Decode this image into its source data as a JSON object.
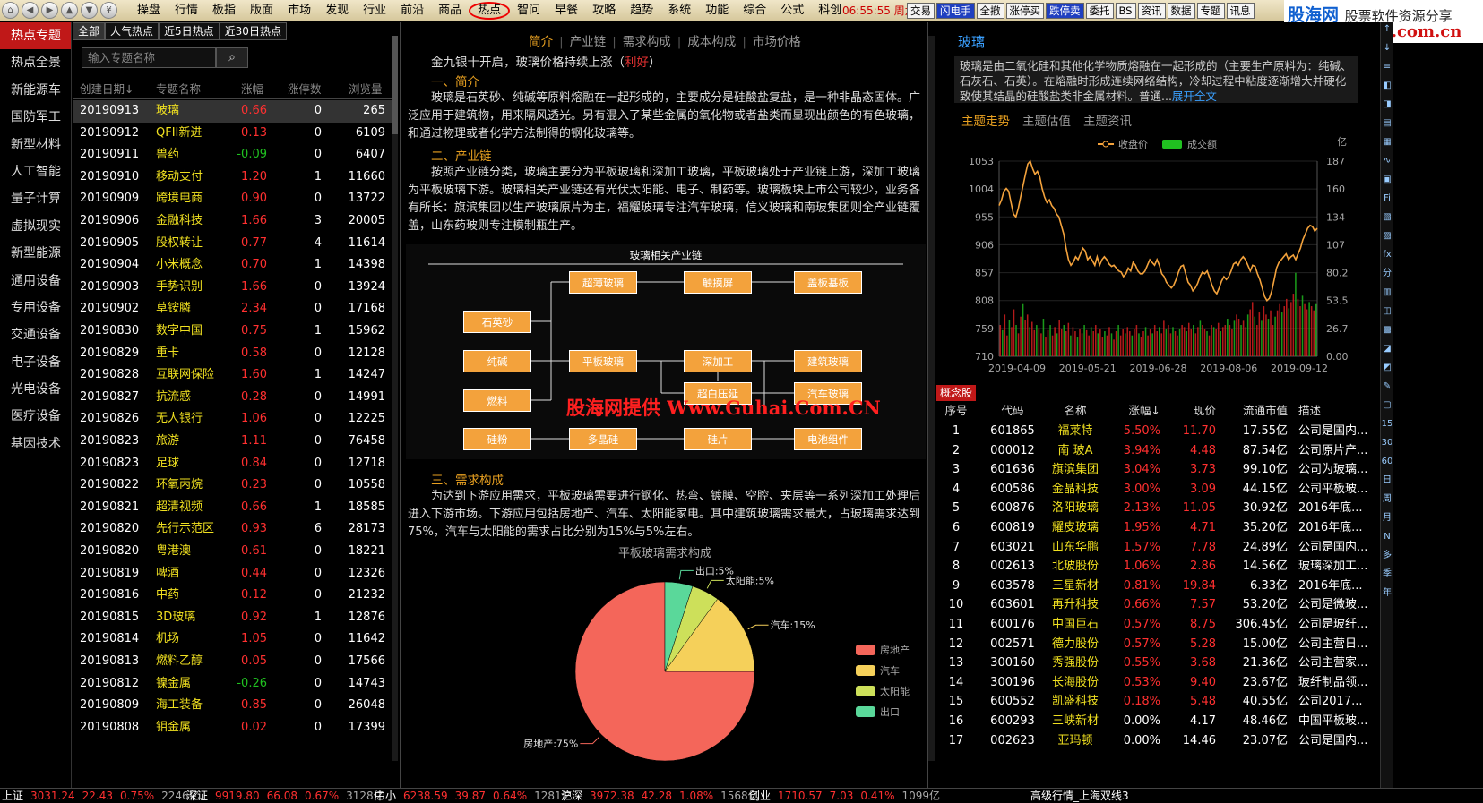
{
  "menu": {
    "items": [
      "操盘",
      "行情",
      "板指",
      "版面",
      "市场",
      "发现",
      "行业",
      "前沿",
      "商品",
      "热点",
      "智问",
      "早餐",
      "攻略",
      "趋势",
      "系统",
      "功能",
      "综合",
      "公式",
      "科创"
    ],
    "active": "热点",
    "time": "06:55:55",
    "weekday": "周六"
  },
  "quick_buttons": [
    "交易",
    "闪电手",
    "全撤",
    "涨停买",
    "跌停卖",
    "委托",
    "BS",
    "资讯",
    "数据",
    "专题",
    "讯息"
  ],
  "logo": {
    "line1": "股海网",
    "line1b": "股票软件资源分享",
    "line2": "Www.Guhai.com.cn"
  },
  "categories": [
    "热点专题",
    "热点全景",
    "新能源车",
    "国防军工",
    "新型材料",
    "人工智能",
    "量子计算",
    "虚拟现实",
    "新型能源",
    "通用设备",
    "专用设备",
    "交通设备",
    "电子设备",
    "光电设备",
    "医疗设备",
    "基因技术"
  ],
  "topic_tabs": [
    "全部",
    "人气热点",
    "近5日热点",
    "近30日热点"
  ],
  "topic_search": {
    "placeholder": "输入专题名称"
  },
  "topic_headers": [
    "创建日期↓",
    "专题名称",
    "涨幅",
    "涨停数",
    "浏览量"
  ],
  "topics": [
    [
      "20190913",
      "玻璃",
      "0.66",
      "0",
      "265",
      "up"
    ],
    [
      "20190912",
      "QFII新进",
      "0.13",
      "0",
      "6109",
      "up"
    ],
    [
      "20190911",
      "兽药",
      "-0.09",
      "0",
      "6407",
      "down"
    ],
    [
      "20190910",
      "移动支付",
      "1.20",
      "1",
      "11660",
      "up"
    ],
    [
      "20190909",
      "跨境电商",
      "0.90",
      "0",
      "13722",
      "up"
    ],
    [
      "20190906",
      "金融科技",
      "1.66",
      "3",
      "20005",
      "up"
    ],
    [
      "20190905",
      "股权转让",
      "0.77",
      "4",
      "11614",
      "up"
    ],
    [
      "20190904",
      "小米概念",
      "0.70",
      "1",
      "14398",
      "up"
    ],
    [
      "20190903",
      "手势识别",
      "1.66",
      "0",
      "13924",
      "up"
    ],
    [
      "20190902",
      "草铵膦",
      "2.34",
      "0",
      "17168",
      "up"
    ],
    [
      "20190830",
      "数字中国",
      "0.75",
      "1",
      "15962",
      "up"
    ],
    [
      "20190829",
      "重卡",
      "0.58",
      "0",
      "12128",
      "up"
    ],
    [
      "20190828",
      "互联网保险",
      "1.60",
      "1",
      "14247",
      "up"
    ],
    [
      "20190827",
      "抗流感",
      "0.28",
      "0",
      "14991",
      "up"
    ],
    [
      "20190826",
      "无人银行",
      "1.06",
      "0",
      "12225",
      "up"
    ],
    [
      "20190823",
      "旅游",
      "1.11",
      "0",
      "76458",
      "up"
    ],
    [
      "20190823",
      "足球",
      "0.84",
      "0",
      "12718",
      "up"
    ],
    [
      "20190822",
      "环氧丙烷",
      "0.23",
      "0",
      "10558",
      "up"
    ],
    [
      "20190821",
      "超清视频",
      "0.66",
      "1",
      "18585",
      "up"
    ],
    [
      "20190820",
      "先行示范区",
      "0.93",
      "6",
      "28173",
      "up"
    ],
    [
      "20190820",
      "粤港澳",
      "0.61",
      "0",
      "18221",
      "up"
    ],
    [
      "20190819",
      "啤酒",
      "0.44",
      "0",
      "12326",
      "up"
    ],
    [
      "20190816",
      "中药",
      "0.12",
      "0",
      "21232",
      "up"
    ],
    [
      "20190815",
      "3D玻璃",
      "0.92",
      "1",
      "12876",
      "up"
    ],
    [
      "20190814",
      "机场",
      "1.05",
      "0",
      "11642",
      "up"
    ],
    [
      "20190813",
      "燃料乙醇",
      "0.05",
      "0",
      "17566",
      "up"
    ],
    [
      "20190812",
      "镍金属",
      "-0.26",
      "0",
      "14743",
      "down"
    ],
    [
      "20190809",
      "海工装备",
      "0.85",
      "0",
      "26048",
      "up"
    ],
    [
      "20190808",
      "钼金属",
      "0.02",
      "0",
      "17399",
      "up"
    ]
  ],
  "article": {
    "tabs": [
      "简介",
      "产业链",
      "需求构成",
      "成本构成",
      "市场价格"
    ],
    "headline": "金九银十开启，玻璃价格持续上涨（",
    "headline_tag": "利好",
    "headline_end": "）",
    "sec1": "一、简介",
    "p1": "玻璃是石英砂、纯碱等原料熔融在一起形成的，主要成分是硅酸盐复盐，是一种非晶态固体。广泛应用于建筑物，用来隔风透光。另有混入了某些金属的氧化物或者盐类而显现出颜色的有色玻璃，和通过物理或者化学方法制得的钢化玻璃等。",
    "sec2": "二、产业链",
    "p2": "按照产业链分类，玻璃主要分为平板玻璃和深加工玻璃，平板玻璃处于产业链上游，深加工玻璃为平板玻璃下游。玻璃相关产业链还有光伏太阳能、电子、制药等。玻璃板块上市公司较少，业务各有所长：旗滨集团以生产玻璃原片为主，福耀玻璃专注汽车玻璃，信义玻璃和南玻集团则全产业链覆盖，山东药玻则专注模制瓶生产。",
    "diagram_title": "玻璃相关产业链",
    "diagram_nodes": [
      "石英砂",
      "纯碱",
      "燃料",
      "硅粉",
      "超薄玻璃",
      "平板玻璃",
      "多晶硅",
      "触摸屏",
      "深加工",
      "超白压延",
      "硅片",
      "盖板基板",
      "建筑玻璃",
      "汽车玻璃",
      "电池组件"
    ],
    "watermark": "股海网提供 Www.Guhai.Com.CN",
    "sec3": "三、需求构成",
    "p3": "为达到下游应用需求，平板玻璃需要进行钢化、热弯、镀膜、空腔、夹层等一系列深加工处理后进入下游市场。下游应用包括房地产、汽车、太阳能家电。其中建筑玻璃需求最大，占玻璃需求达到75%，汽车与太阳能的需求占比分别为15%与5%左右。"
  },
  "chart_data": [
    {
      "type": "pie",
      "title": "平板玻璃需求构成",
      "categories": [
        "房地产",
        "汽车",
        "太阳能",
        "出口"
      ],
      "values": [
        75,
        15,
        5,
        5
      ],
      "colors": [
        "#f4665a",
        "#f5d05a",
        "#cde05a",
        "#5ad89a"
      ],
      "labels": [
        "房地产:75%",
        "汽车:15%",
        "太阳能:5%",
        "出口:5%"
      ],
      "legend": "right"
    },
    {
      "type": "line",
      "title": "主题走势",
      "series": [
        {
          "name": "收盘价",
          "axis": "left",
          "color": "#f3a23c",
          "values": [
            975,
            985,
            1000,
            1005,
            1000,
            980,
            960,
            955,
            970,
            990,
            1010,
            1030,
            1048,
            1053,
            1040,
            1030,
            1035,
            1025,
            1005,
            990,
            980,
            985,
            975,
            970,
            960,
            955,
            940,
            925,
            900,
            880,
            870,
            875,
            885,
            880,
            890,
            900,
            895,
            880,
            885,
            878,
            870,
            885,
            870,
            880,
            885,
            880,
            872,
            868,
            870,
            865,
            860,
            858,
            850,
            855,
            865,
            860,
            875,
            870,
            860,
            855,
            855,
            860,
            870,
            880,
            875,
            870,
            880,
            870,
            855,
            850,
            840,
            835,
            830,
            835,
            845,
            858,
            868,
            870,
            855,
            840,
            835,
            825,
            830,
            838,
            850,
            858,
            855,
            860,
            848,
            835,
            825,
            820,
            830,
            842,
            850,
            845,
            850,
            860,
            872,
            875,
            870,
            880,
            885,
            880,
            870,
            860,
            870,
            868,
            855,
            845,
            830,
            815,
            808,
            812,
            825,
            845,
            865,
            875,
            880,
            885,
            890,
            880,
            885,
            888,
            880,
            890,
            900,
            915,
            925,
            935,
            940,
            938,
            930,
            935
          ]
        },
        {
          "name": "成交额",
          "axis": "right",
          "type": "bar",
          "colors": [
            "#e02020",
            "#20c020"
          ],
          "values": [
            30,
            25,
            40,
            20,
            35,
            28,
            45,
            30,
            22,
            38,
            50,
            35,
            40,
            28,
            33,
            25,
            30,
            27,
            22,
            36,
            18,
            25,
            30,
            20,
            28,
            22,
            35,
            26,
            30,
            24,
            32,
            20,
            28,
            24,
            18,
            26,
            22,
            30,
            25,
            20,
            28,
            24,
            30,
            22,
            26,
            18,
            24,
            20,
            28,
            22,
            16,
            24,
            30,
            20,
            26,
            22,
            28,
            24,
            20,
            26,
            30,
            22,
            18,
            24,
            28,
            20,
            26,
            22,
            30,
            24,
            28,
            22,
            34,
            26,
            30,
            22,
            28,
            24,
            20,
            26,
            30,
            28,
            24,
            32,
            26,
            30,
            22,
            28,
            34,
            30,
            26,
            24,
            20,
            30,
            28,
            26,
            32,
            24,
            28,
            30,
            36,
            30,
            26,
            34,
            40,
            36,
            30,
            34,
            28,
            40,
            45,
            52,
            38,
            30,
            42,
            34,
            48,
            40,
            36,
            44,
            30,
            38,
            44,
            50,
            42,
            48,
            55,
            46,
            52,
            60,
            80,
            55,
            48,
            58,
            50,
            45,
            52,
            48,
            44,
            50
          ]
        }
      ],
      "x_ticks": [
        "2019-04-09",
        "2019-05-21",
        "2019-06-28",
        "2019-08-06",
        "2019-09-12"
      ],
      "y_left_ticks": [
        "1053",
        "1004",
        "955",
        "906",
        "857",
        "808",
        "759",
        "710"
      ],
      "y_right_ticks": [
        "187",
        "160",
        "134",
        "107",
        "80.2",
        "53.5",
        "26.7",
        "0.00"
      ],
      "y_right_unit": "亿",
      "ylim_left": [
        710,
        1053
      ],
      "ylim_right": [
        0,
        187
      ],
      "legend": "top"
    }
  ],
  "right": {
    "title": "玻璃",
    "desc": "玻璃是由二氧化硅和其他化学物质熔融在一起形成的（主要生产原料为：纯碱、石灰石、石英）。在熔融时形成连续网络结构，冷却过程中粘度逐渐增大并硬化致使其结晶的硅酸盐类非金属材料。普通...",
    "more": "展开全文",
    "tabs": [
      "主题走势",
      "主题估值",
      "主题资讯"
    ],
    "concept_title": "概念股",
    "headers": [
      "序号",
      "代码",
      "名称",
      "涨幅↓",
      "现价",
      "流通市值",
      "描述"
    ],
    "stocks": [
      [
        "1",
        "601865",
        "福莱特",
        "5.50%",
        "11.70",
        "17.55亿",
        "公司是国内..."
      ],
      [
        "2",
        "000012",
        "南 玻A",
        "3.94%",
        "4.48",
        "87.54亿",
        "公司原片产..."
      ],
      [
        "3",
        "601636",
        "旗滨集团",
        "3.04%",
        "3.73",
        "99.10亿",
        "公司为玻璃..."
      ],
      [
        "4",
        "600586",
        "金晶科技",
        "3.00%",
        "3.09",
        "44.15亿",
        "公司平板玻..."
      ],
      [
        "5",
        "600876",
        "洛阳玻璃",
        "2.13%",
        "11.05",
        "30.92亿",
        "2016年底..."
      ],
      [
        "6",
        "600819",
        "耀皮玻璃",
        "1.95%",
        "4.71",
        "35.20亿",
        "2016年底..."
      ],
      [
        "7",
        "603021",
        "山东华鹏",
        "1.57%",
        "7.78",
        "24.89亿",
        "公司是国内..."
      ],
      [
        "8",
        "002613",
        "北玻股份",
        "1.06%",
        "2.86",
        "14.56亿",
        "玻璃深加工..."
      ],
      [
        "9",
        "603578",
        "三星新材",
        "0.81%",
        "19.84",
        "6.33亿",
        "2016年底..."
      ],
      [
        "10",
        "603601",
        "再升科技",
        "0.66%",
        "7.57",
        "53.20亿",
        "公司是微玻..."
      ],
      [
        "11",
        "600176",
        "中国巨石",
        "0.57%",
        "8.75",
        "306.45亿",
        "公司是玻纤..."
      ],
      [
        "12",
        "002571",
        "德力股份",
        "0.57%",
        "5.28",
        "15.00亿",
        "公司主营日..."
      ],
      [
        "13",
        "300160",
        "秀强股份",
        "0.55%",
        "3.68",
        "21.36亿",
        "公司主营家..."
      ],
      [
        "14",
        "300196",
        "长海股份",
        "0.53%",
        "9.40",
        "23.67亿",
        "玻纤制品领..."
      ],
      [
        "15",
        "600552",
        "凯盛科技",
        "0.18%",
        "5.48",
        "40.55亿",
        "公司2017..."
      ],
      [
        "16",
        "600293",
        "三峡新材",
        "0.00%",
        "4.17",
        "48.46亿",
        "中国平板玻..."
      ],
      [
        "17",
        "002623",
        "亚玛顿",
        "0.00%",
        "14.46",
        "23.07亿",
        "公司是国内..."
      ]
    ]
  },
  "right_tools": [
    "↑",
    "↓",
    "≡",
    "◧",
    "◨",
    "▤",
    "▦",
    "∿",
    "▣",
    "Fi",
    "▧",
    "▨",
    "fx",
    "分",
    "▥",
    "◫",
    "▩",
    "◪",
    "◩",
    "✎",
    "▢",
    "15",
    "30",
    "60",
    "日",
    "周",
    "月",
    "N",
    "多",
    "季",
    "年"
  ],
  "status": {
    "items": [
      {
        "name": "上证",
        "v1": "3031.24",
        "v2": "22.43",
        "v3": "0.75%",
        "v4": "2246亿"
      },
      {
        "name": "深证",
        "v1": "9919.80",
        "v2": "66.08",
        "v3": "0.67%",
        "v4": "3128亿"
      },
      {
        "name": "中小",
        "v1": "6238.59",
        "v2": "39.87",
        "v3": "0.64%",
        "v4": "1281亿"
      },
      {
        "name": "沪深",
        "v1": "3972.38",
        "v2": "42.28",
        "v3": "1.08%",
        "v4": "1568亿"
      },
      {
        "name": "创业",
        "v1": "1710.57",
        "v2": "7.03",
        "v3": "0.41%",
        "v4": "1099亿"
      }
    ],
    "right_text": "高级行情_上海双线3"
  }
}
